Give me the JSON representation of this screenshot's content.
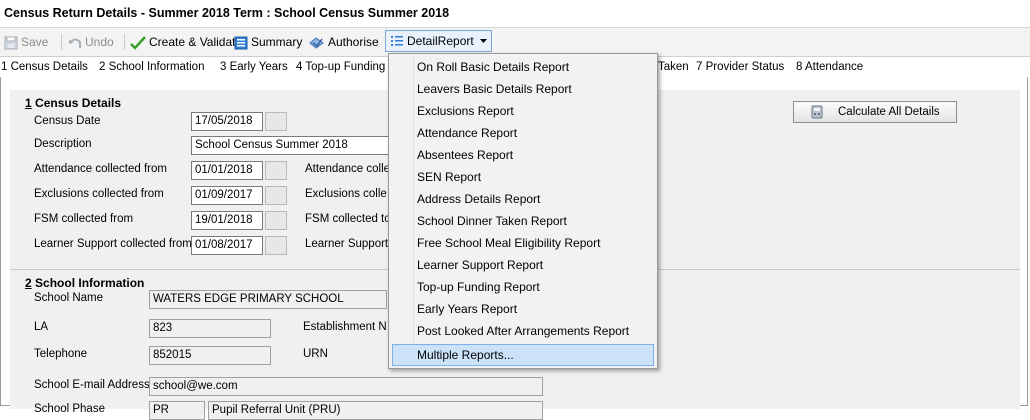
{
  "window": {
    "title": "Census Return Details - Summer 2018 Term : School Census Summer 2018"
  },
  "toolbar": {
    "save": "Save",
    "undo": "Undo",
    "create_validate": "Create & Validate",
    "summary": "Summary",
    "authorise": "Authorise",
    "detail_report": "DetailReport"
  },
  "nav_tabs": [
    "1 Census Details",
    "2 School Information",
    "3 Early Years",
    "4 Top-up Funding",
    "Taken",
    "7 Provider Status",
    "8 Attendance"
  ],
  "census_details": {
    "heading_num": "1",
    "heading_text": " Census Details",
    "census_date_label": "Census Date",
    "census_date": "17/05/2018",
    "description_label": "Description",
    "description": "School Census Summer 2018",
    "attendance_from_label": "Attendance collected from",
    "attendance_from": "01/01/2018",
    "attendance_to_label": "Attendance colle",
    "exclusions_from_label": "Exclusions collected from",
    "exclusions_from": "01/09/2017",
    "exclusions_to_label": "Exclusions colle",
    "fsm_from_label": "FSM collected from",
    "fsm_from": "19/01/2018",
    "fsm_to_label": "FSM collected to",
    "learner_support_from_label": "Learner Support collected from",
    "learner_support_from": "01/08/2017",
    "learner_support_to_label": "Learner Support",
    "calculate_all": "Calculate All Details"
  },
  "school_info": {
    "heading_num": "2",
    "heading_text": " School Information",
    "school_name_label": "School Name",
    "school_name": "WATERS EDGE PRIMARY SCHOOL",
    "la_label": "LA",
    "la": "823",
    "establishment_label": "Establishment N",
    "telephone_label": "Telephone",
    "telephone": "852015",
    "urn_label": "URN",
    "email_label": "School E-mail Address",
    "email": "school@we.com",
    "phase_label": "School Phase",
    "phase_code": "PR",
    "phase_desc": "Pupil Referral Unit (PRU)"
  },
  "dropdown": {
    "items": [
      "On Roll Basic Details Report",
      "Leavers Basic Details Report",
      "Exclusions Report",
      "Attendance Report",
      "Absentees Report",
      "SEN Report",
      "Address Details Report",
      "School Dinner Taken Report",
      "Free School Meal Eligibility Report",
      "Learner Support Report",
      "Top-up Funding Report",
      "Early Years Report",
      "Post Looked After Arrangements Report",
      "Multiple Reports..."
    ],
    "selected_index": 13
  },
  "colors": {
    "accent": "#3b84d8",
    "highlight": "#cce2f8"
  }
}
